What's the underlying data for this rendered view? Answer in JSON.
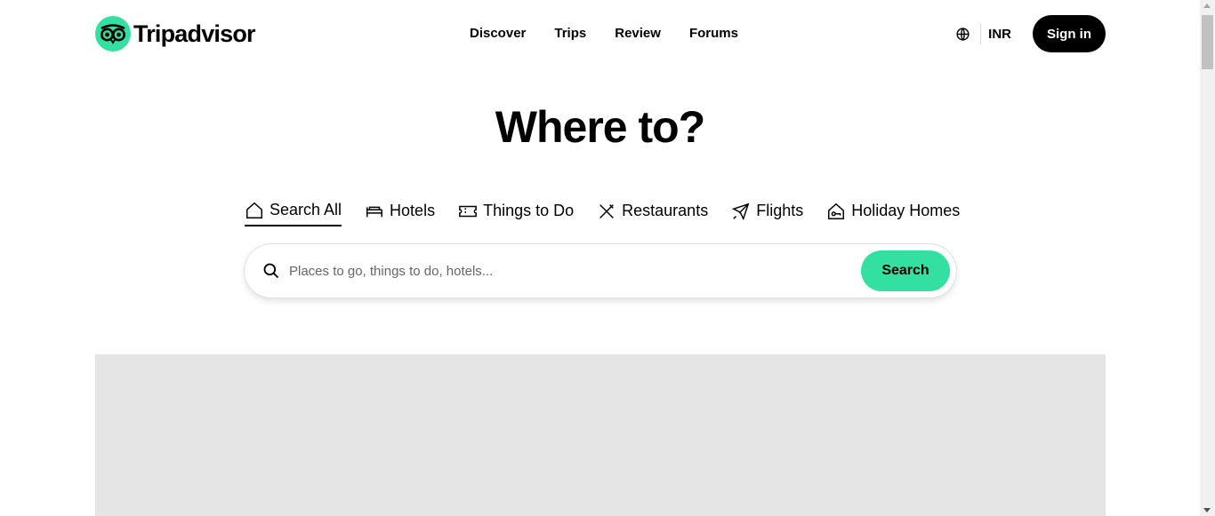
{
  "brand": {
    "name": "Tripadvisor",
    "accent": "#34e0a1"
  },
  "nav": [
    {
      "label": "Discover"
    },
    {
      "label": "Trips"
    },
    {
      "label": "Review"
    },
    {
      "label": "Forums"
    }
  ],
  "header": {
    "currency": "INR",
    "signin_label": "Sign in",
    "globe_icon": "globe-icon"
  },
  "hero": {
    "title": "Where to?"
  },
  "tabs": [
    {
      "label": "Search All",
      "icon": "home-icon",
      "active": true
    },
    {
      "label": "Hotels",
      "icon": "bed-icon"
    },
    {
      "label": "Things to Do",
      "icon": "ticket-icon"
    },
    {
      "label": "Restaurants",
      "icon": "cutlery-icon"
    },
    {
      "label": "Flights",
      "icon": "plane-icon"
    },
    {
      "label": "Holiday Homes",
      "icon": "house-key-icon"
    }
  ],
  "search": {
    "placeholder": "Places to go, things to do, hotels...",
    "value": "",
    "button_label": "Search"
  }
}
